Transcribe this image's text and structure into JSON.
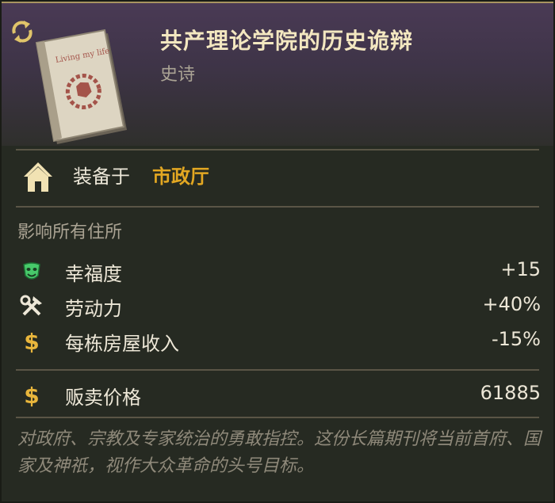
{
  "item": {
    "title": "共产理论学院的历史诡辩",
    "rarity": "史诗",
    "book_cover_text": "Living my life"
  },
  "equip": {
    "label": "装备于",
    "value": "市政厅"
  },
  "affects_header": "影响所有住所",
  "effects": [
    {
      "icon": "happiness-mask-icon",
      "label": "幸福度",
      "value": "+15"
    },
    {
      "icon": "tools-icon",
      "label": "劳动力",
      "value": "+40%"
    },
    {
      "icon": "dollar-icon",
      "label": "每栋房屋收入",
      "value": "-15%"
    }
  ],
  "sell": {
    "icon": "dollar-icon",
    "label": "贩卖价格",
    "value": "61885"
  },
  "flavor_text": "对政府、宗教及专家统治的勇敢指控。这份长篇期刊将当前首府、国家及神祇，视作大众革命的头号目标。",
  "colors": {
    "title": "#f3e7c0",
    "accent_gold": "#e2a722",
    "header_purple": "#4a3a55",
    "background": "#262a22"
  }
}
